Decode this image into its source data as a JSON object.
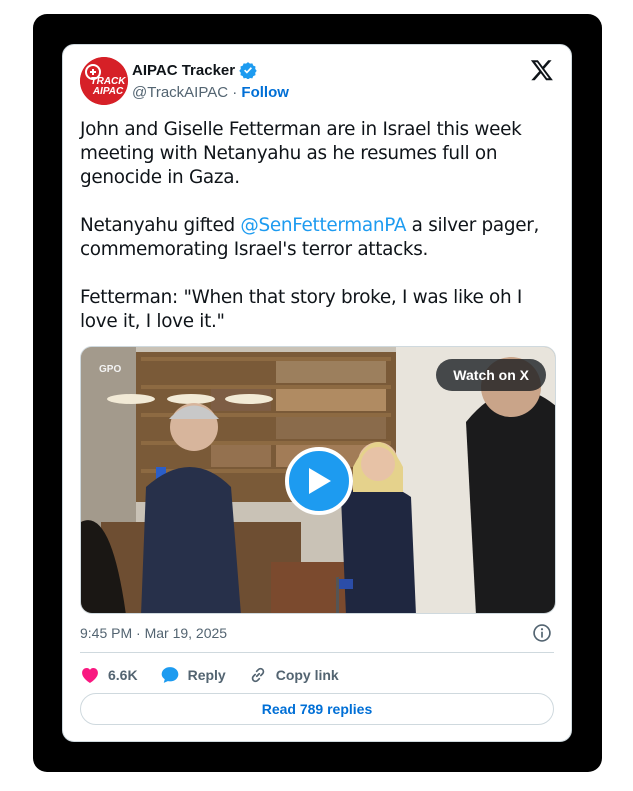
{
  "author": {
    "name": "AIPAC Tracker",
    "handle": "@TrackAIPAC",
    "separator": "·",
    "follow_label": "Follow",
    "avatar_text_line1": "TRACK",
    "avatar_text_line2": "AIPAC"
  },
  "tweet": {
    "text_part1": "John and Giselle Fetterman are in Israel this week meeting with Netanyahu as he resumes full on genocide in Gaza.\n\nNetanyahu gifted ",
    "mention": "@SenFettermanPA",
    "text_part2": " a silver pager, commemorating Israel's terror attacks.\n\nFetterman: \"When that story broke, I was like oh I love it, I love it.\""
  },
  "media": {
    "watch_label": "Watch on X",
    "gpo_label": "GPO"
  },
  "timestamp": "9:45 PM · Mar 19, 2025",
  "actions": {
    "likes": "6.6K",
    "reply_label": "Reply",
    "copy_label": "Copy link"
  },
  "read_replies_label": "Read 789 replies",
  "colors": {
    "accent": "#1d9bf0",
    "link": "#006fd6",
    "like": "#f91880",
    "avatar_bg": "#d62027"
  }
}
